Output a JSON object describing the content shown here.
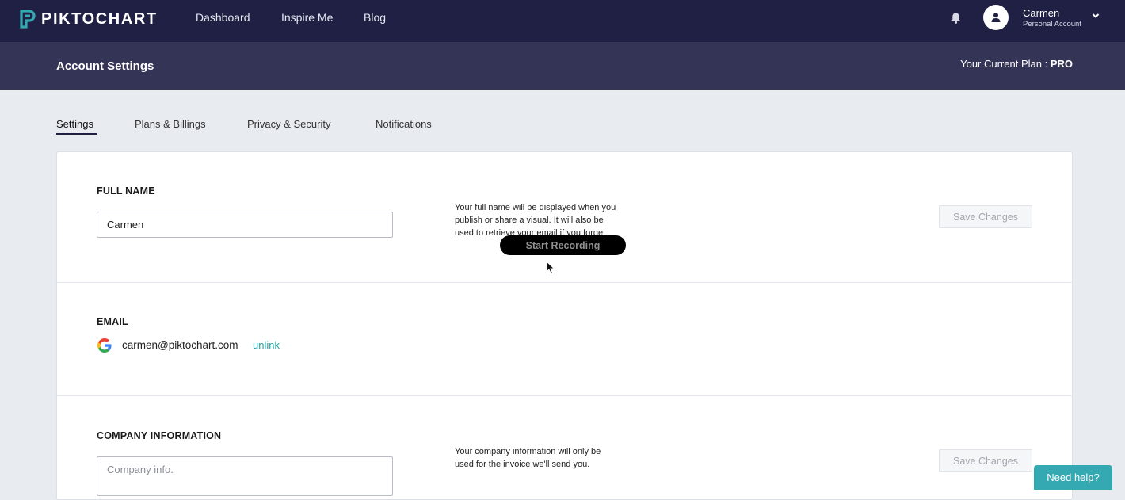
{
  "brand": {
    "name": "PIKTOCHART",
    "accent": "#35a9b1"
  },
  "nav": {
    "links": [
      "Dashboard",
      "Inspire Me",
      "Blog"
    ],
    "icons": {
      "notifications": "bell-icon",
      "user": "user-icon",
      "menu": "chevron-down-icon"
    }
  },
  "user": {
    "name": "Carmen",
    "account_type": "Personal Account"
  },
  "subheader": {
    "title": "Account Settings",
    "plan_label": "Your Current Plan :",
    "plan_value": "PRO"
  },
  "tabs": [
    {
      "label": "Settings",
      "active": true
    },
    {
      "label": "Plans & Billings",
      "active": false
    },
    {
      "label": "Privacy & Security",
      "active": false
    },
    {
      "label": "Notifications",
      "active": false
    }
  ],
  "sections": {
    "full_name": {
      "label": "FULL NAME",
      "value": "Carmen",
      "help": "Your full name will be displayed when you publish or share a visual. It will also be used to retrieve your email if you forget",
      "save_label": "Save Changes"
    },
    "email": {
      "label": "EMAIL",
      "provider_icon": "google-icon",
      "value": "carmen@piktochart.com",
      "unlink_label": "unlink"
    },
    "company": {
      "label": "COMPANY INFORMATION",
      "placeholder": "Company info.",
      "help": "Your company information will only be used for the invoice we'll send you.",
      "save_label": "Save Changes"
    }
  },
  "overlay": {
    "recording_label": "Start Recording"
  },
  "support": {
    "label": "Need help?"
  }
}
